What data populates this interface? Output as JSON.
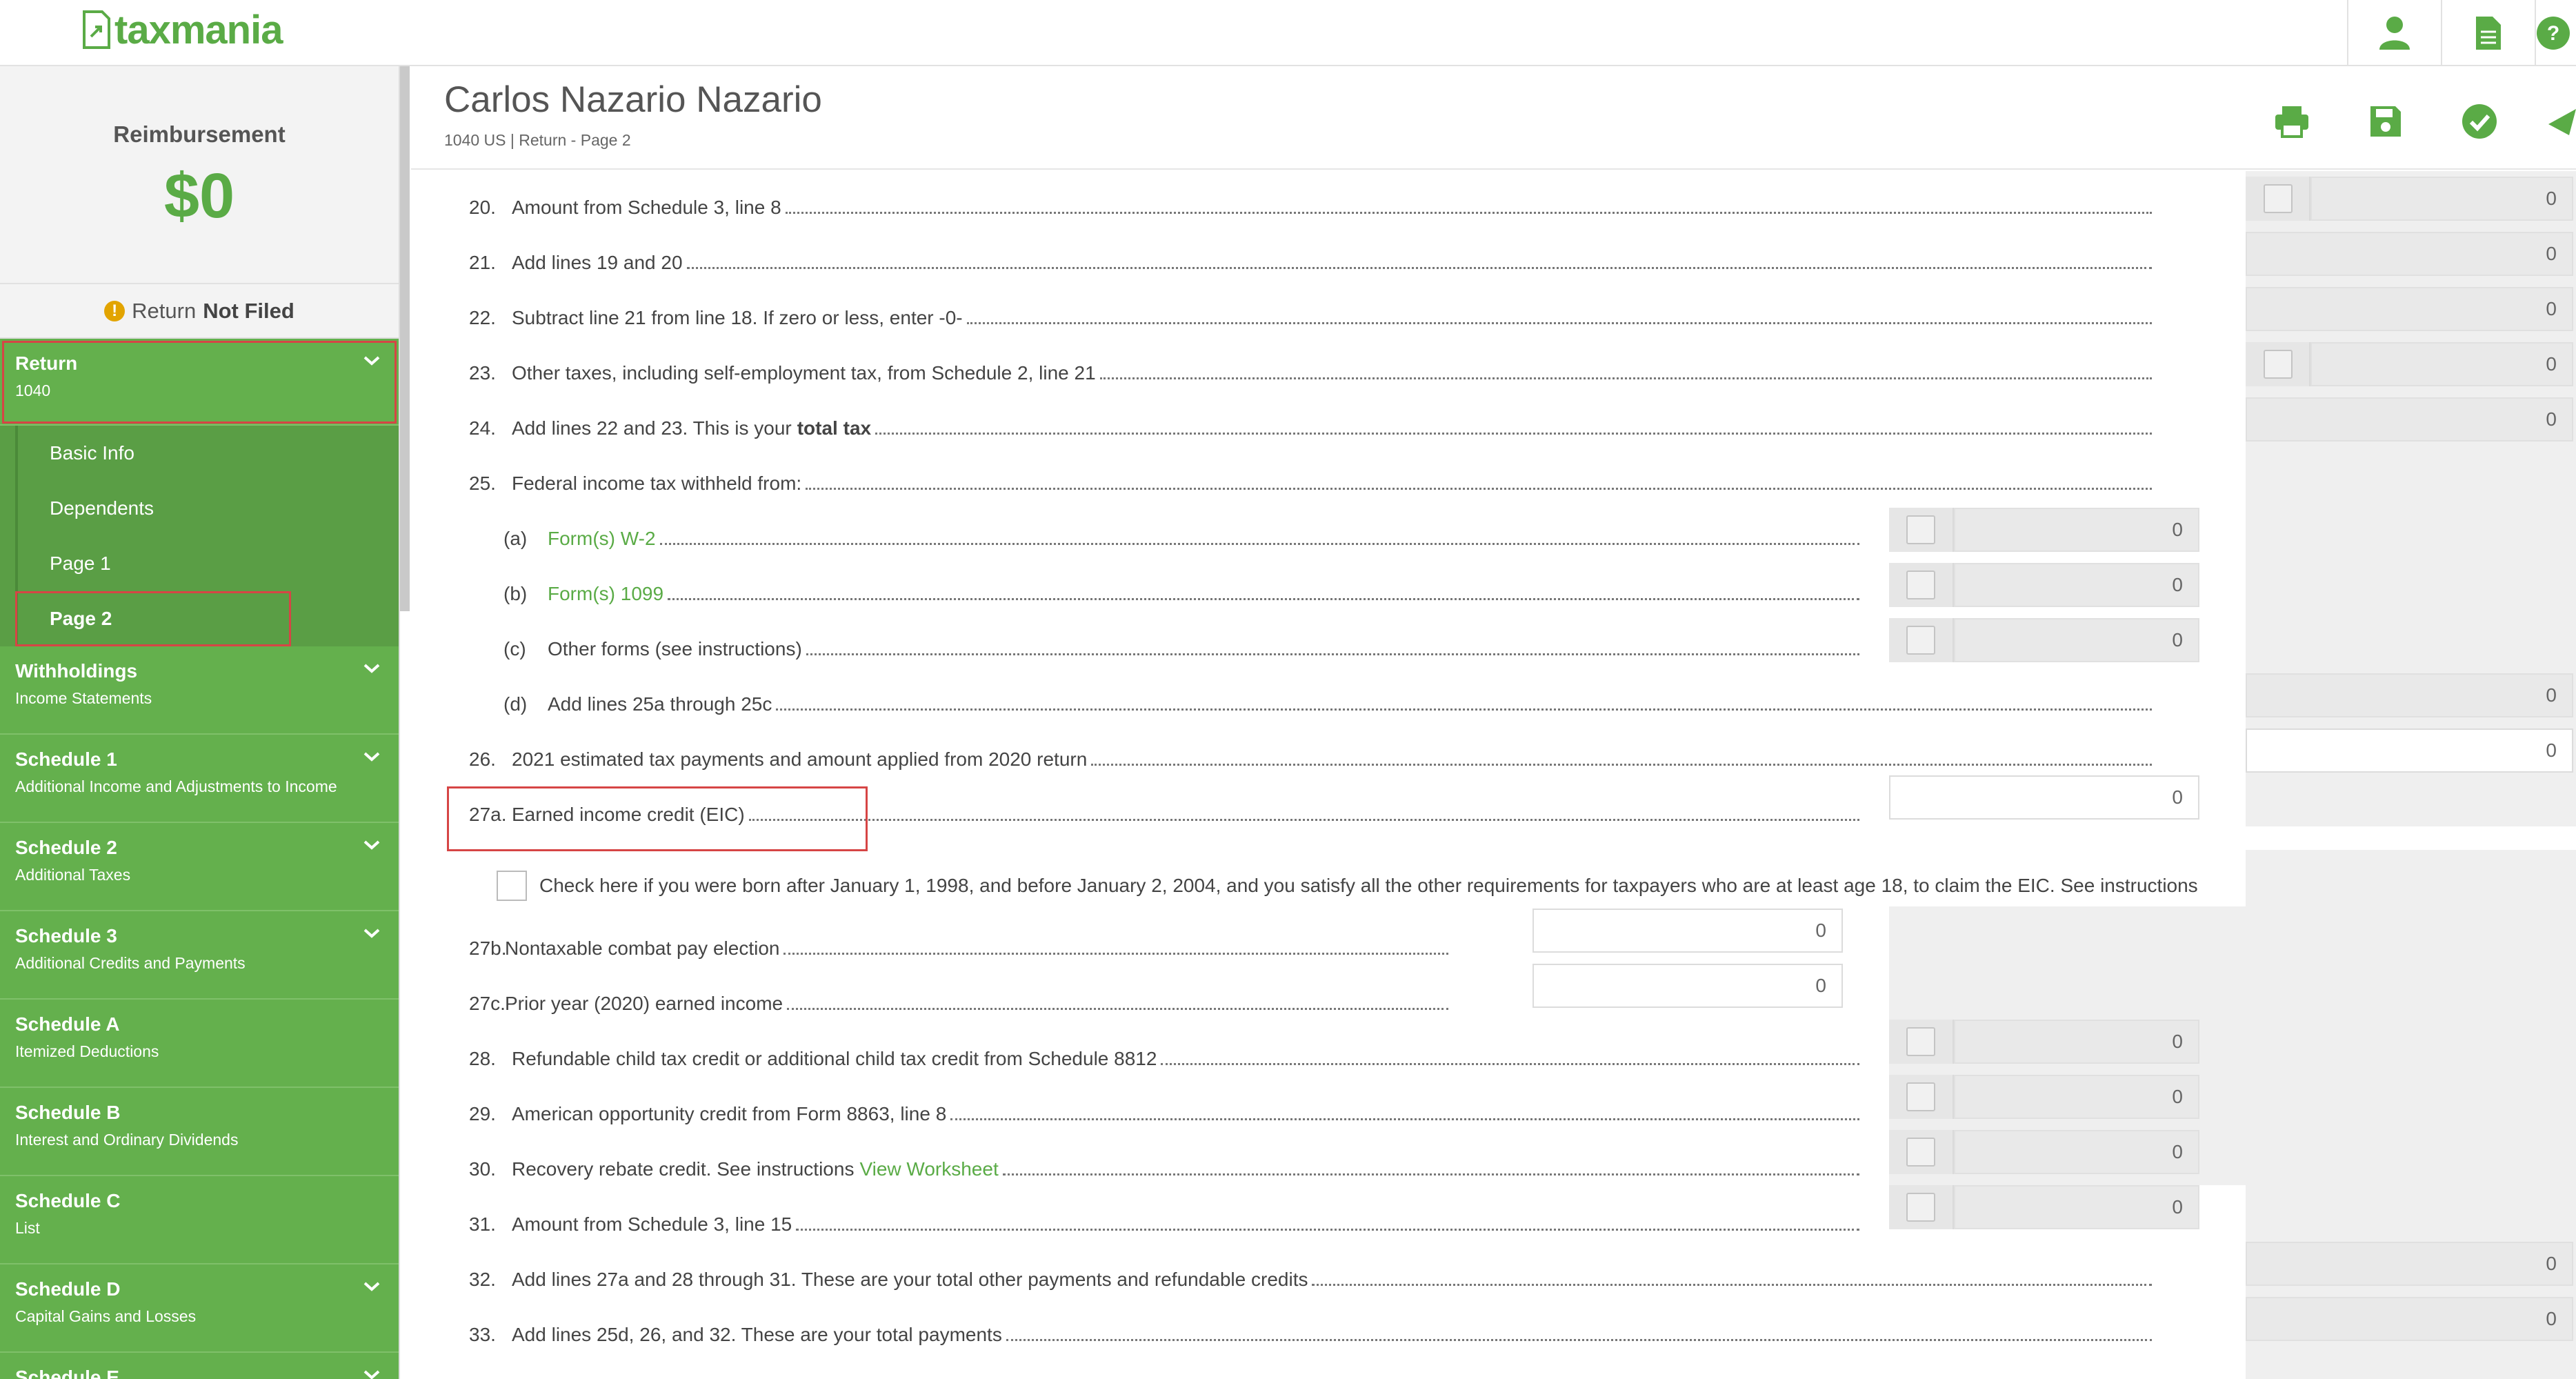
{
  "app": {
    "name": "taxmania"
  },
  "sidebar": {
    "reimbursement_label": "Reimbursement",
    "reimbursement_amount": "$0",
    "status_prefix": "Return",
    "status_value": "Not Filed",
    "return_section": {
      "title": "Return",
      "subtitle": "1040"
    },
    "return_items": [
      "Basic Info",
      "Dependents",
      "Page 1",
      "Page 2"
    ],
    "sections": [
      {
        "title": "Withholdings",
        "subtitle": "Income Statements"
      },
      {
        "title": "Schedule 1",
        "subtitle": "Additional Income and Adjustments to Income"
      },
      {
        "title": "Schedule 2",
        "subtitle": "Additional Taxes"
      },
      {
        "title": "Schedule 3",
        "subtitle": "Additional Credits and Payments"
      },
      {
        "title": "Schedule A",
        "subtitle": "Itemized Deductions"
      },
      {
        "title": "Schedule B",
        "subtitle": "Interest and Ordinary Dividends"
      },
      {
        "title": "Schedule C",
        "subtitle": "List"
      },
      {
        "title": "Schedule D",
        "subtitle": "Capital Gains and Losses"
      },
      {
        "title": "Schedule E",
        "subtitle": ""
      }
    ]
  },
  "header": {
    "name": "Carlos Nazario Nazario",
    "breadcrumb": "1040 US | Return - Page 2"
  },
  "form": {
    "lines": [
      {
        "num": "20.",
        "label": "Amount from Schedule 3, line 8",
        "value": "0"
      },
      {
        "num": "21.",
        "label": "Add lines 19 and 20",
        "value": "0"
      },
      {
        "num": "22.",
        "label": "Subtract line 21 from line 18. If zero or less, enter -0-",
        "value": "0"
      },
      {
        "num": "23.",
        "label": "Other taxes, including self-employment tax, from Schedule 2, line 21",
        "value": "0"
      },
      {
        "num": "24.",
        "label": "Add lines 22 and 23. This is your",
        "bold": "total tax",
        "value": "0"
      },
      {
        "num": "25.",
        "label": "Federal income tax withheld from:"
      },
      {
        "num": "(a)",
        "label": "Form(s) W-2",
        "value": "0"
      },
      {
        "num": "(b)",
        "label": "Form(s) 1099",
        "value": "0"
      },
      {
        "num": "(c)",
        "label": "Other forms (see instructions)",
        "value": "0"
      },
      {
        "num": "(d)",
        "label": "Add lines 25a through 25c",
        "value": "0"
      },
      {
        "num": "26.",
        "label": "2021 estimated tax payments and amount applied from 2020 return",
        "value": "0"
      },
      {
        "num": "27a.",
        "label": "Earned income credit (EIC)",
        "value": "0"
      },
      {
        "num": "",
        "label": "Check here if you were born after January 1, 1998, and before January 2, 2004, and you satisfy all the other requirements for taxpayers who are at least age 18, to claim the EIC. See instructions"
      },
      {
        "num": "27b.",
        "label": "Nontaxable combat pay election",
        "value": "0"
      },
      {
        "num": "27c.",
        "label": "Prior year (2020) earned income",
        "value": "0"
      },
      {
        "num": "28.",
        "label": "Refundable child tax credit or additional child tax credit from Schedule 8812",
        "value": "0"
      },
      {
        "num": "29.",
        "label": "American opportunity credit from Form 8863, line 8",
        "value": "0"
      },
      {
        "num": "30.",
        "label": "Recovery rebate credit. See instructions",
        "link": "View Worksheet",
        "value": "0"
      },
      {
        "num": "31.",
        "label": "Amount from Schedule 3, line 15",
        "value": "0"
      },
      {
        "num": "32.",
        "label": "Add lines 27a and 28 through 31. These are your total other payments and refundable credits",
        "value": "0"
      },
      {
        "num": "33.",
        "label": "Add lines 25d, 26, and 32. These are your total payments",
        "value": "0"
      }
    ]
  },
  "colors": {
    "brand": "#5aab46",
    "sidebar": "#64b04d",
    "highlight": "#d64545"
  },
  "icons": {
    "top": [
      "user-icon",
      "document-icon",
      "help-icon"
    ],
    "actions": [
      "print-icon",
      "save-icon",
      "check-circle-icon",
      "send-icon"
    ]
  }
}
